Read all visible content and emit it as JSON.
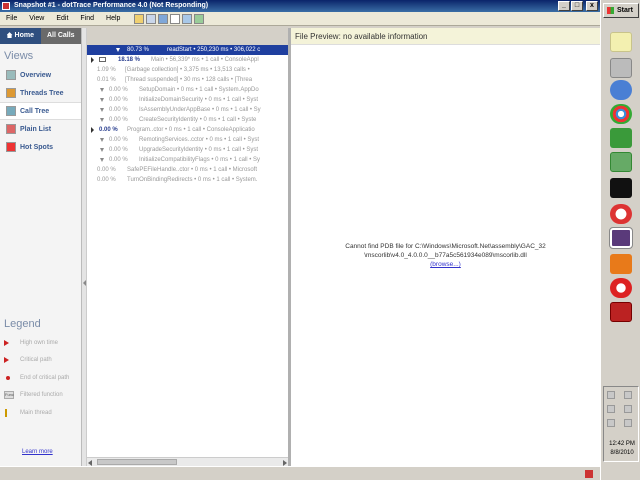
{
  "window": {
    "title": "Snapshot #1 - dotTrace Performance 4.0 (Not Responding)"
  },
  "window_buttons": {
    "minimize": "_",
    "maximize": "□",
    "close": "x"
  },
  "menu": [
    "File",
    "View",
    "Edit",
    "Find",
    "Help"
  ],
  "tabs": {
    "home": "Home",
    "all_calls": "All Calls"
  },
  "views": {
    "title": "Views",
    "items": [
      "Overview",
      "Threads Tree",
      "Call Tree",
      "Plain List",
      "Hot Spots"
    ],
    "selected": "Call Tree"
  },
  "call_tree": {
    "rows": [
      {
        "pct": "80.73 %",
        "text": "readStart • 250,230 ms • 306,022 c"
      },
      {
        "pct": "18.18 %",
        "text": "Main • 56,339* ms • 1 call • ConsoleAppl"
      },
      {
        "pct": "1.09 %",
        "text": "[Garbage collection] • 3,375 ms • 13,513 calls •"
      },
      {
        "pct": "0.01 %",
        "text": "[Thread suspended] • 30 ms • 128 calls • [Threa"
      },
      {
        "pct": "0.00 %",
        "text": "SetupDomain • 0 ms • 1 call • System.AppDo"
      },
      {
        "pct": "0.00 %",
        "text": "InitializeDomainSecurity • 0 ms • 1 call • Syst"
      },
      {
        "pct": "0.00 %",
        "text": "IsAssemblyUnderAppBase • 0 ms • 1 call • Sy"
      },
      {
        "pct": "0.00 %",
        "text": "CreateSecurityIdentity • 0 ms • 1 call • Syste"
      },
      {
        "pct": "0.00 %",
        "text": "Program..ctor • 0 ms • 1 call • ConsoleApplicatio"
      },
      {
        "pct": "0.00 %",
        "text": "RemotingServices..cctor • 0 ms • 1 call • Syst"
      },
      {
        "pct": "0.00 %",
        "text": "UpgradeSecurityIdentity • 0 ms • 1 call • Syst"
      },
      {
        "pct": "0.00 %",
        "text": "InitializeCompatibilityFlags • 0 ms • 1 call • Sy"
      },
      {
        "pct": "0.00 %",
        "text": "SafePEFileHandle..ctor • 0 ms • 1 call • Microsoft"
      },
      {
        "pct": "0.00 %",
        "text": "TurnOnBindingRedirects • 0 ms • 1 call • System."
      }
    ]
  },
  "preview": {
    "header": "File Preview: no available information",
    "message_line1": "Cannot find PDB file for C:\\Windows\\Microsoft.Net\\assembly\\GAC_32",
    "message_line2": "\\mscorlib\\v4.0_4.0.0.0__b77a5c561934e089\\mscorlib.dll",
    "browse_link": "(browse...)"
  },
  "legend": {
    "title": "Legend",
    "items": [
      "High own time",
      "Critical path",
      "End of critical path",
      "Filtered function",
      "Main thread"
    ],
    "filter_badge": "Func",
    "learn_more": "Learn more"
  },
  "taskbar": {
    "start": "Start",
    "clock_time": "12:42 PM",
    "clock_date": "8/8/2010"
  },
  "colors": {
    "selected_row": "#1f3f9f",
    "nav_text": "#3a5a90",
    "preview_header_bg": "#f4f3d9"
  }
}
